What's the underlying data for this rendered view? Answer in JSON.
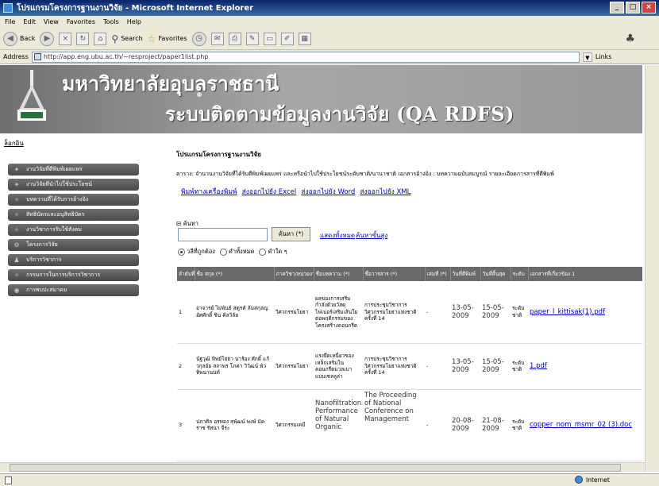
{
  "window": {
    "title": "โปรแกรมโครงการฐานงานวิจัย - Microsoft Internet Explorer"
  },
  "menu": [
    "File",
    "Edit",
    "View",
    "Favorites",
    "Tools",
    "Help"
  ],
  "toolbar": {
    "back": "Back",
    "search": "Search",
    "favorites": "Favorites"
  },
  "address": {
    "label": "Address",
    "url": "http://app.eng.ubu.ac.th/~resproject/paper1list.php",
    "links": "Links"
  },
  "banner": {
    "university": "มหาวิทยาลัยอุบลราชธานี",
    "system": "ระบบติดตามข้อมูลงานวิจัย (QA RDFS)"
  },
  "sidebar": {
    "logout": "ล็อกอิน",
    "items": [
      {
        "label": "งานวิจัยที่ตีพิมพ์เผยแพร่",
        "icon": "star-icon"
      },
      {
        "label": "งานวิจัยที่นำไปใช้ประโยชน์",
        "icon": "star-icon"
      },
      {
        "label": "บทความที่ได้รับการอ้างอิง",
        "icon": "pin-icon"
      },
      {
        "label": "สิทธิบัตรและอนุสิทธิบัตร",
        "icon": "pin-icon"
      },
      {
        "label": "งานวิชาการรับใช้สังคม",
        "icon": "pin-icon"
      },
      {
        "label": "โครงการวิจัย",
        "icon": "gear-icon"
      },
      {
        "label": "บริการวิชาการ",
        "icon": "person-icon"
      },
      {
        "label": "กรรมการในการบริการวิชาการ",
        "icon": "pin-icon"
      },
      {
        "label": "การพบปะสมาคม",
        "icon": "globe-icon"
      }
    ]
  },
  "content": {
    "title": "โปรแกรมโครงการฐานงานวิจัย",
    "description": "ตาราง: จำนวนงานวิจัยที่ได้รับตีพิมพ์เผยแพร่ และหรือนำไปใช้ประโยชน์ระดับชาติ/นานาชาติ เอกสารอ้างอิง : บทความฉบับสมบูรณ์ รายละเอียดการสารที่ตีพิมพ์",
    "export_links": [
      "พิมพ์ทางเครื่องพิมพ์",
      "ส่งออกไปยัง Excel",
      "ส่งออกไปยัง Word",
      "ส่งออกไปยัง XML"
    ],
    "search": {
      "label": "⊟ ค้นหา",
      "value": "",
      "button": "ค้นหา (*)",
      "show_all": "แสดงทั้งหมด",
      "advanced": "ค้นหาขั้นสูง",
      "options": [
        "วลีที่ถูกต้อง",
        "คำทั้งหมด",
        "คำใด ๆ"
      ]
    }
  },
  "table": {
    "headers": [
      "ลำดับที่",
      "ชื่อ สกุล (*)",
      "ภาควิชา/หน่วยงาน",
      "ชื่อบทความ (*)",
      "ชื่อวารสาร (*)",
      "เล่มที่ (*)",
      "วันที่ตีพิมพ์",
      "วันที่สิ้นสุด",
      "ระดับ",
      "เอกสารที่เกี่ยวข้อง 1"
    ],
    "rows": [
      {
        "no": "1",
        "name": "อาจารย์ ไม่พันธ์ สตูรค์ ล้มสกุลญ อัศศักดิ์ ชิน คิลวิลัย",
        "dept": "วิศวกรรมโยธา",
        "article": "ผลของการเสริมกำลังด้วยวัสดุไฟเบอร์เสริมเส้นใย ต่อพฤติกรรมของโครงสร้างคอนกรีต",
        "journal": "การประชุมวิชาการวิศวกรรมโยธาแห่งชาติ ครั้งที่ 14",
        "volume": "-",
        "date_pub": "13-05-2009",
        "date_end": "15-05-2009",
        "level": "ระดับชาติ",
        "file": "paper_l_kittisak(1).pdf"
      },
      {
        "no": "2",
        "name": "นัฐวุฒิ ทิพย์โยธา นาร้อง ศักดิ์ แก้วกุลยัย สถาพร โภคา วิวัฒน์ พัวทิพนานนท์",
        "dept": "วิศวกรรมโยธา",
        "article": "แรงยึดเหนี่ยวของเหล็กเสริมในคอนกรีตมวลเบาแบบเซลลูล่า",
        "journal": "การประชุมวิชาการวิศวกรรมโยธาแห่งชาติ ครั้งที่ 14",
        "volume": "-",
        "date_pub": "13-05-2009",
        "date_end": "15-05-2009",
        "level": "ระดับชาติ",
        "file": "1.pdf"
      },
      {
        "no": "3",
        "name": "ปภาศิล อรทอง สุพัฒน์ พงษ์ มัคราช รัทนา จีระ",
        "dept": "วิศวกรรมเคมี",
        "article": "Nanofiltration Performance of Natural Organic",
        "journal": "The Proceeding of National Conference on Management",
        "volume": "-",
        "date_pub": "20-08-2009",
        "date_end": "21-08-2009",
        "level": "ระดับชาติ",
        "file": "copper_nom_msmr_02 (3).doc"
      }
    ]
  },
  "status": {
    "zone": "Internet"
  }
}
